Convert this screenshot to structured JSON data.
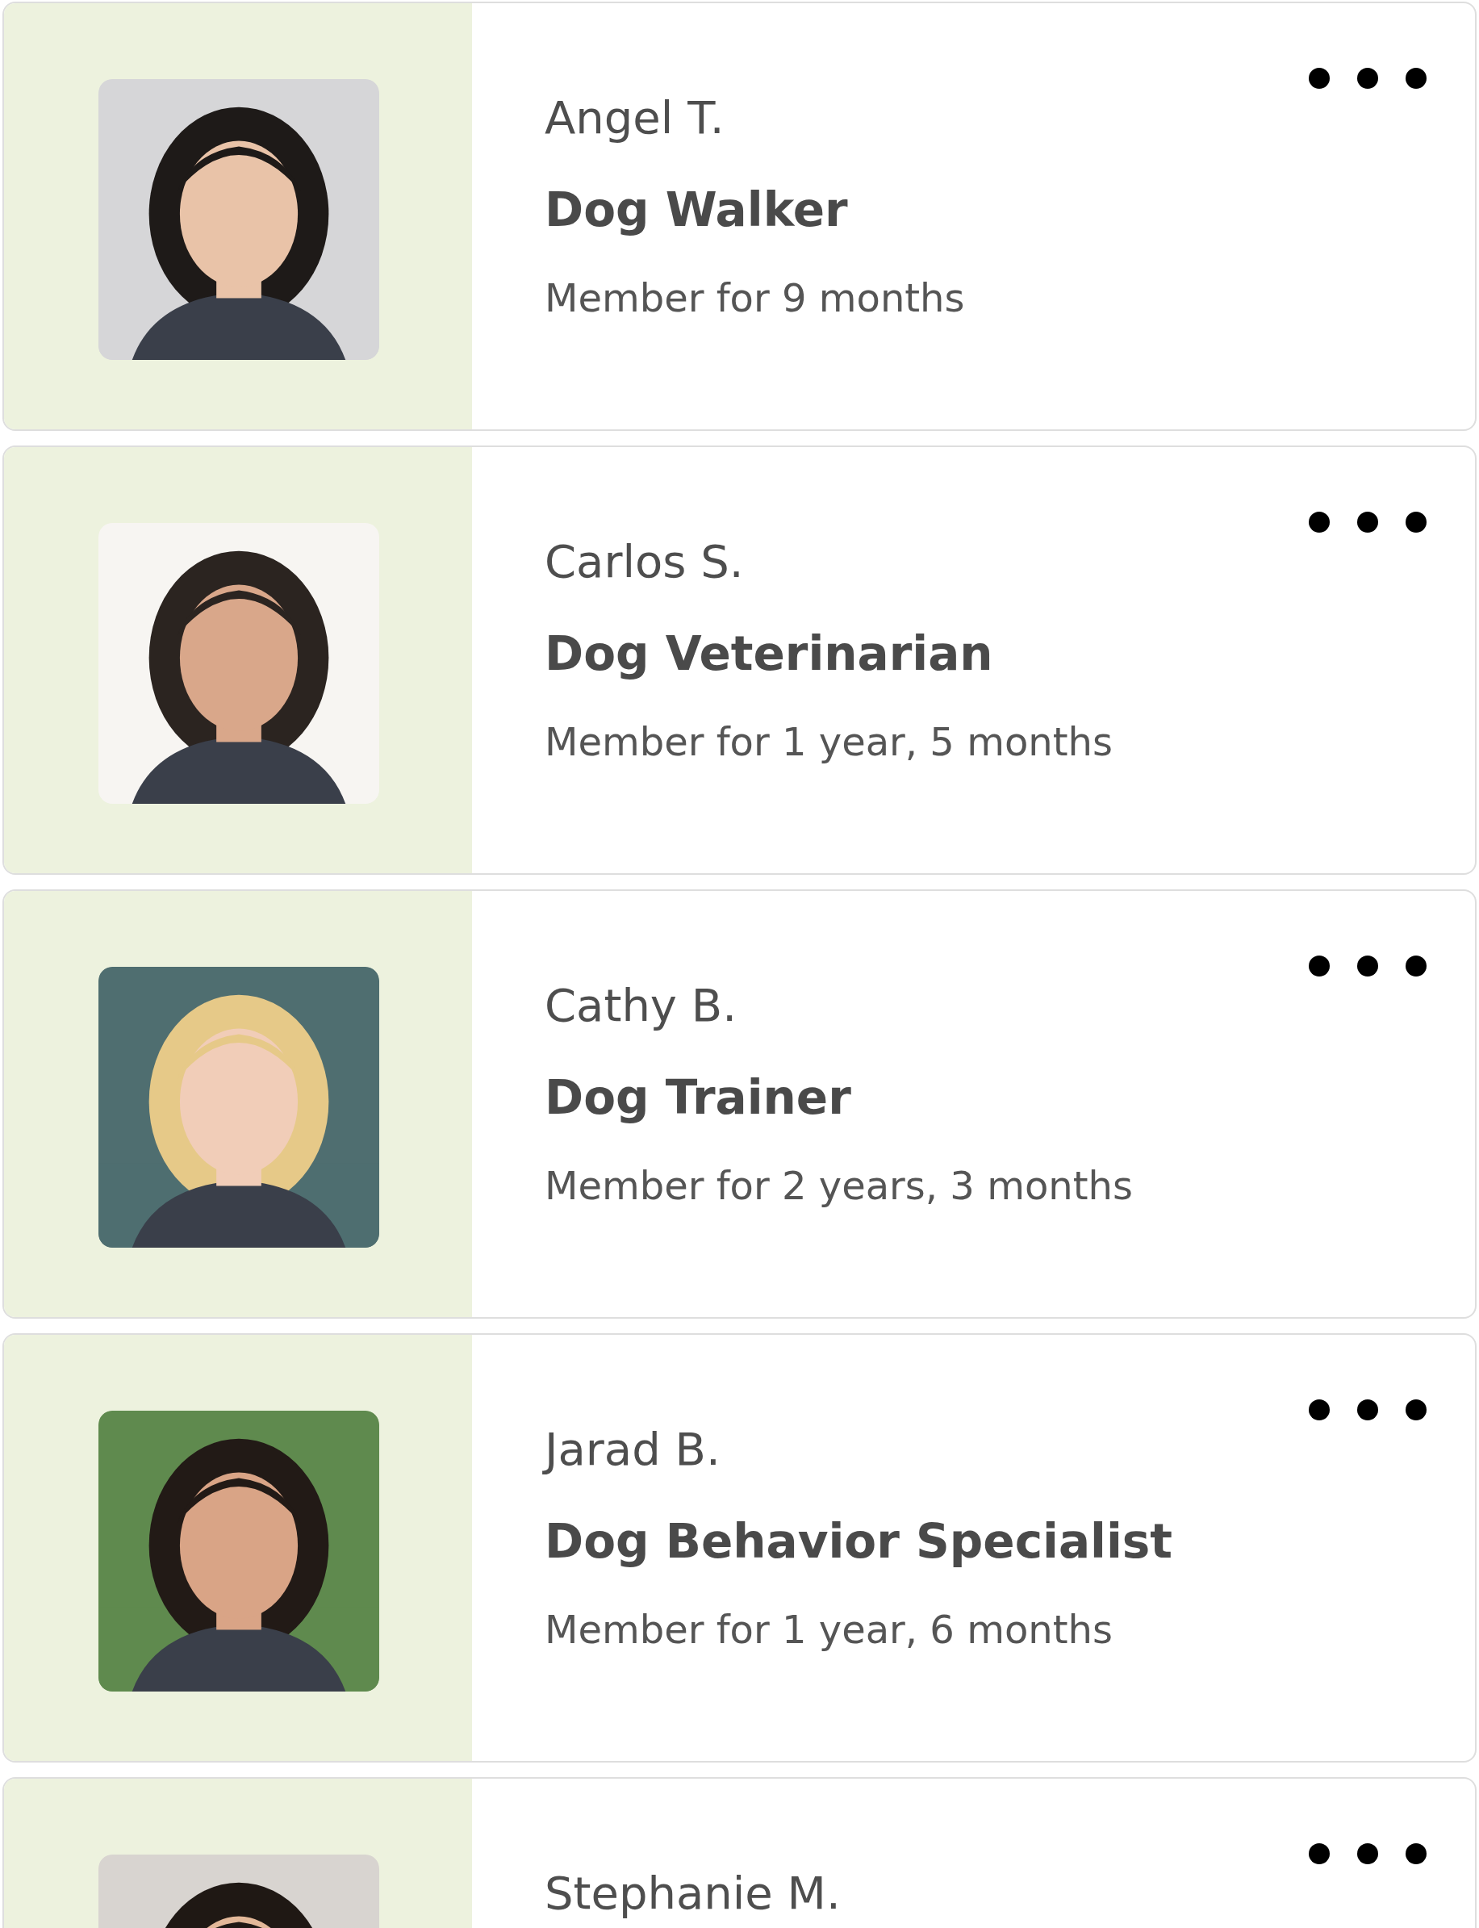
{
  "members": [
    {
      "name": "Angel T.",
      "role": "Dog Walker",
      "tenure": "Member for 9 months"
    },
    {
      "name": "Carlos S.",
      "role": "Dog Veterinarian",
      "tenure": "Member for 1 year, 5 months"
    },
    {
      "name": "Cathy B.",
      "role": "Dog Trainer",
      "tenure": "Member for 2 years, 3 months"
    },
    {
      "name": "Jarad B.",
      "role": "Dog Behavior Specialist",
      "tenure": "Member for 1 year, 6 months"
    },
    {
      "name": "Stephanie M."
    }
  ]
}
